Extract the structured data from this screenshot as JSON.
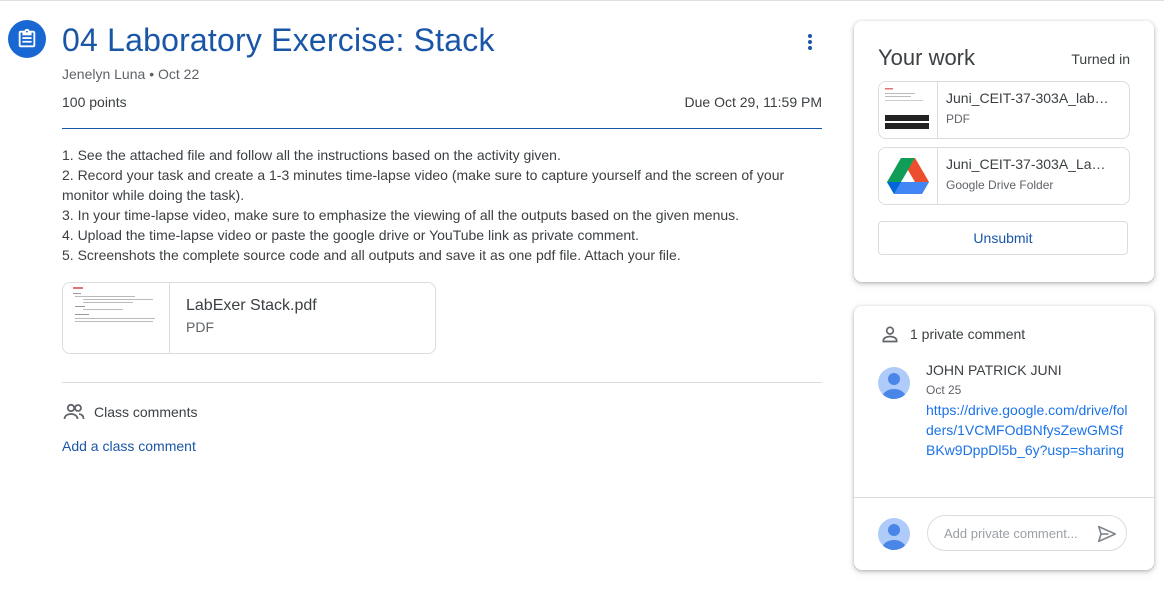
{
  "assignment": {
    "title": "04 Laboratory Exercise: Stack",
    "author": "Jenelyn Luna",
    "date": "Oct 22",
    "points": "100 points",
    "due": "Due Oct 29, 11:59 PM",
    "instructions": [
      "1. See the attached file and follow all the instructions based on the activity given.",
      "2. Record your task and create a 1-3 minutes time-lapse video (make sure to capture yourself and the screen of your monitor while doing the task).",
      "3. In your time-lapse video, make sure to emphasize the viewing of all the outputs based on the given menus.",
      "4. Upload the time-lapse video or paste the google drive or YouTube link as private comment.",
      "5. Screenshots the complete source code and all outputs and save it as one pdf file. Attach your file."
    ],
    "attachment": {
      "name": "LabExer Stack.pdf",
      "type": "PDF"
    }
  },
  "class_comments": {
    "label": "Class comments",
    "add_label": "Add a class comment"
  },
  "your_work": {
    "title": "Your work",
    "status": "Turned in",
    "files": [
      {
        "name": "Juni_CEIT-37-303A_lab…",
        "type": "PDF"
      },
      {
        "name": "Juni_CEIT-37-303A_La…",
        "type": "Google Drive Folder"
      }
    ],
    "unsubmit_label": "Unsubmit"
  },
  "private_comments": {
    "header": "1 private comment",
    "comment": {
      "author": "JOHN PATRICK JUNI",
      "date": "Oct 25",
      "text": "https://drive.google.com/drive/folders/1VCMFOdBNfysZewGMSfBKw9DppDl5b_6y?usp=sharing"
    },
    "input_placeholder": "Add private comment..."
  },
  "colors": {
    "accent": "#1a56a8",
    "link": "#1a73e8",
    "icon_bg": "#1967d2",
    "avatar": "#aecbfa"
  }
}
